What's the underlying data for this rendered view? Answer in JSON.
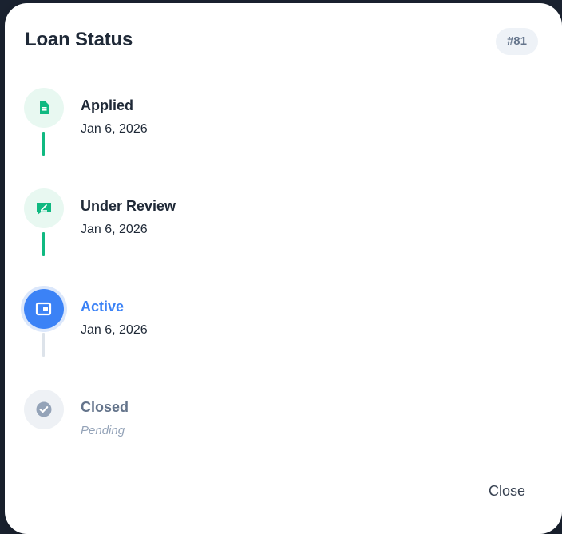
{
  "modal": {
    "title": "Loan Status",
    "badge": "#81",
    "close_label": "Close"
  },
  "steps": [
    {
      "label": "Applied",
      "date": "Jan 6, 2026",
      "status": "done",
      "icon": "document-icon"
    },
    {
      "label": "Under Review",
      "date": "Jan 6, 2026",
      "status": "done",
      "icon": "review-icon"
    },
    {
      "label": "Active",
      "date": "Jan 6, 2026",
      "status": "active",
      "icon": "wallet-icon"
    },
    {
      "label": "Closed",
      "date": "Pending",
      "status": "pending",
      "icon": "check-circle-icon"
    }
  ],
  "colors": {
    "done": "#10b981",
    "active": "#3b82f6",
    "pending": "#94a3b8"
  }
}
